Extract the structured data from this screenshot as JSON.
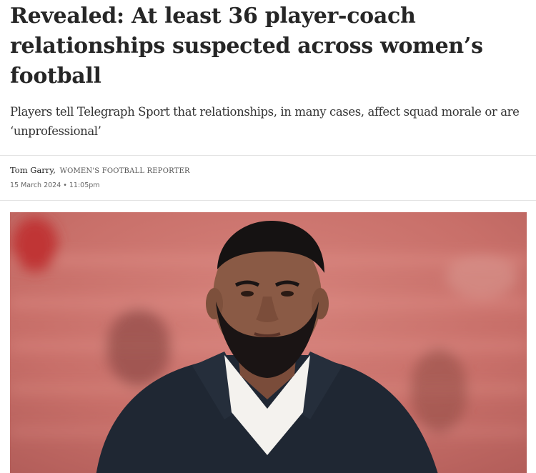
{
  "article": {
    "headline": "Revealed: At least 36 player-coach relationships suspected across women’s football",
    "standfirst": "Players tell Telegraph Sport that relationships, in many cases, affect squad morale or are ‘unprofessional’",
    "author": "Tom Garry,",
    "author_role": "WOMEN'S FOOTBALL REPORTER",
    "date": "15 March 2024",
    "separator": "•",
    "time": "11:05pm"
  },
  "image": {
    "subject": "man-in-dark-jacket-photo",
    "background_color": "#c96f69",
    "jacket_color": "#1f2733",
    "shirt_color": "#f4f2ee",
    "skin_color": "#8a5a45",
    "hair_color": "#151212"
  }
}
